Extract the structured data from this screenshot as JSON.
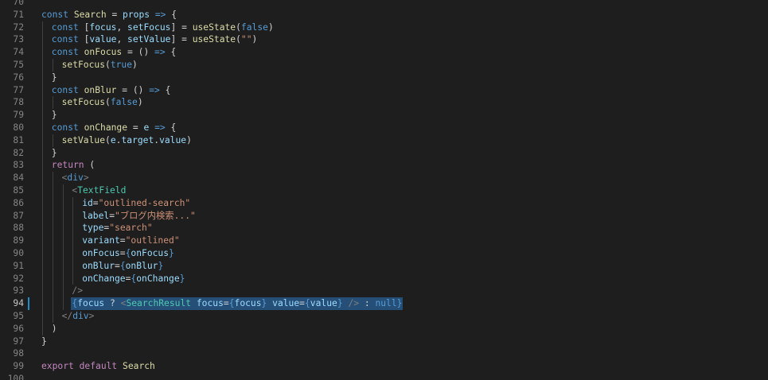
{
  "editor": {
    "language": "javascript-react",
    "active_line": 94,
    "colors": {
      "background": "#1e1e1e",
      "line_number": "#858585",
      "keyword": "#569cd6",
      "control": "#c586c0",
      "function": "#dcdcaa",
      "variable": "#9cdcfe",
      "string": "#ce9178",
      "jsx_tag": "#4ec9b0",
      "selection": "#264f78",
      "modified_gutter": "#1e8fc6"
    },
    "lines": [
      {
        "num": "70",
        "indent": 0,
        "tokens": []
      },
      {
        "num": "71",
        "indent": 0,
        "tokens": [
          [
            "kw",
            "const"
          ],
          [
            "txt",
            " "
          ],
          [
            "fn",
            "Search"
          ],
          [
            "txt",
            " = "
          ],
          [
            "var",
            "props"
          ],
          [
            "txt",
            " "
          ],
          [
            "kw",
            "=>"
          ],
          [
            "txt",
            " {"
          ]
        ]
      },
      {
        "num": "72",
        "indent": 1,
        "tokens": [
          [
            "kw",
            "const"
          ],
          [
            "txt",
            " ["
          ],
          [
            "var",
            "focus"
          ],
          [
            "txt",
            ", "
          ],
          [
            "var",
            "setFocus"
          ],
          [
            "txt",
            "] = "
          ],
          [
            "fn",
            "useState"
          ],
          [
            "txt",
            "("
          ],
          [
            "lit",
            "false"
          ],
          [
            "txt",
            ")"
          ]
        ]
      },
      {
        "num": "73",
        "indent": 1,
        "tokens": [
          [
            "kw",
            "const"
          ],
          [
            "txt",
            " ["
          ],
          [
            "var",
            "value"
          ],
          [
            "txt",
            ", "
          ],
          [
            "var",
            "setValue"
          ],
          [
            "txt",
            "] = "
          ],
          [
            "fn",
            "useState"
          ],
          [
            "txt",
            "("
          ],
          [
            "str",
            "\"\""
          ],
          [
            "txt",
            ")"
          ]
        ]
      },
      {
        "num": "74",
        "indent": 1,
        "tokens": [
          [
            "kw",
            "const"
          ],
          [
            "txt",
            " "
          ],
          [
            "fn",
            "onFocus"
          ],
          [
            "txt",
            " = () "
          ],
          [
            "kw",
            "=>"
          ],
          [
            "txt",
            " {"
          ]
        ]
      },
      {
        "num": "75",
        "indent": 2,
        "tokens": [
          [
            "fn",
            "setFocus"
          ],
          [
            "txt",
            "("
          ],
          [
            "lit",
            "true"
          ],
          [
            "txt",
            ")"
          ]
        ]
      },
      {
        "num": "76",
        "indent": 1,
        "tokens": [
          [
            "txt",
            "}"
          ]
        ]
      },
      {
        "num": "77",
        "indent": 1,
        "tokens": [
          [
            "kw",
            "const"
          ],
          [
            "txt",
            " "
          ],
          [
            "fn",
            "onBlur"
          ],
          [
            "txt",
            " = () "
          ],
          [
            "kw",
            "=>"
          ],
          [
            "txt",
            " {"
          ]
        ]
      },
      {
        "num": "78",
        "indent": 2,
        "tokens": [
          [
            "fn",
            "setFocus"
          ],
          [
            "txt",
            "("
          ],
          [
            "lit",
            "false"
          ],
          [
            "txt",
            ")"
          ]
        ]
      },
      {
        "num": "79",
        "indent": 1,
        "tokens": [
          [
            "txt",
            "}"
          ]
        ]
      },
      {
        "num": "80",
        "indent": 1,
        "tokens": [
          [
            "kw",
            "const"
          ],
          [
            "txt",
            " "
          ],
          [
            "fn",
            "onChange"
          ],
          [
            "txt",
            " = "
          ],
          [
            "var",
            "e"
          ],
          [
            "txt",
            " "
          ],
          [
            "kw",
            "=>"
          ],
          [
            "txt",
            " {"
          ]
        ]
      },
      {
        "num": "81",
        "indent": 2,
        "tokens": [
          [
            "fn",
            "setValue"
          ],
          [
            "txt",
            "("
          ],
          [
            "var",
            "e"
          ],
          [
            "txt",
            "."
          ],
          [
            "var",
            "target"
          ],
          [
            "txt",
            "."
          ],
          [
            "var",
            "value"
          ],
          [
            "txt",
            ")"
          ]
        ]
      },
      {
        "num": "82",
        "indent": 1,
        "tokens": [
          [
            "txt",
            "}"
          ]
        ]
      },
      {
        "num": "83",
        "indent": 1,
        "tokens": [
          [
            "ctl",
            "return"
          ],
          [
            "txt",
            " ("
          ]
        ]
      },
      {
        "num": "84",
        "indent": 2,
        "tokens": [
          [
            "tagp",
            "<"
          ],
          [
            "kw",
            "div"
          ],
          [
            "tagp",
            ">"
          ]
        ]
      },
      {
        "num": "85",
        "indent": 3,
        "tokens": [
          [
            "tagp",
            "<"
          ],
          [
            "tag",
            "TextField"
          ]
        ]
      },
      {
        "num": "86",
        "indent": 4,
        "tokens": [
          [
            "var",
            "id"
          ],
          [
            "txt",
            "="
          ],
          [
            "str",
            "\"outlined-search\""
          ]
        ]
      },
      {
        "num": "87",
        "indent": 4,
        "tokens": [
          [
            "var",
            "label"
          ],
          [
            "txt",
            "="
          ],
          [
            "str",
            "\"ブログ内検索...\""
          ]
        ]
      },
      {
        "num": "88",
        "indent": 4,
        "tokens": [
          [
            "var",
            "type"
          ],
          [
            "txt",
            "="
          ],
          [
            "str",
            "\"search\""
          ]
        ]
      },
      {
        "num": "89",
        "indent": 4,
        "tokens": [
          [
            "var",
            "variant"
          ],
          [
            "txt",
            "="
          ],
          [
            "str",
            "\"outlined\""
          ]
        ]
      },
      {
        "num": "90",
        "indent": 4,
        "tokens": [
          [
            "var",
            "onFocus"
          ],
          [
            "txt",
            "="
          ],
          [
            "kw",
            "{"
          ],
          [
            "var",
            "onFocus"
          ],
          [
            "kw",
            "}"
          ]
        ]
      },
      {
        "num": "91",
        "indent": 4,
        "tokens": [
          [
            "var",
            "onBlur"
          ],
          [
            "txt",
            "="
          ],
          [
            "kw",
            "{"
          ],
          [
            "var",
            "onBlur"
          ],
          [
            "kw",
            "}"
          ]
        ]
      },
      {
        "num": "92",
        "indent": 4,
        "tokens": [
          [
            "var",
            "onChange"
          ],
          [
            "txt",
            "="
          ],
          [
            "kw",
            "{"
          ],
          [
            "var",
            "onChange"
          ],
          [
            "kw",
            "}"
          ]
        ]
      },
      {
        "num": "93",
        "indent": 3,
        "tokens": [
          [
            "tagp",
            "/>"
          ]
        ]
      },
      {
        "num": "94",
        "indent": 3,
        "selected": true,
        "tokens": [
          [
            "kw",
            "{"
          ],
          [
            "var",
            "focus"
          ],
          [
            "txt",
            " ? "
          ],
          [
            "tagp",
            "<"
          ],
          [
            "tag",
            "SearchResult"
          ],
          [
            "txt",
            " "
          ],
          [
            "var",
            "focus"
          ],
          [
            "txt",
            "="
          ],
          [
            "kw",
            "{"
          ],
          [
            "var",
            "focus"
          ],
          [
            "kw",
            "}"
          ],
          [
            "txt",
            " "
          ],
          [
            "var",
            "value"
          ],
          [
            "txt",
            "="
          ],
          [
            "kw",
            "{"
          ],
          [
            "var",
            "value"
          ],
          [
            "kw",
            "}"
          ],
          [
            "txt",
            " "
          ],
          [
            "tagp",
            "/>"
          ],
          [
            "txt",
            " : "
          ],
          [
            "lit",
            "null"
          ],
          [
            "kw",
            "}"
          ]
        ]
      },
      {
        "num": "95",
        "indent": 2,
        "tokens": [
          [
            "tagp",
            "</"
          ],
          [
            "kw",
            "div"
          ],
          [
            "tagp",
            ">"
          ]
        ]
      },
      {
        "num": "96",
        "indent": 1,
        "tokens": [
          [
            "txt",
            ")"
          ]
        ]
      },
      {
        "num": "97",
        "indent": 0,
        "tokens": [
          [
            "txt",
            "}"
          ]
        ]
      },
      {
        "num": "98",
        "indent": 0,
        "tokens": []
      },
      {
        "num": "99",
        "indent": 0,
        "tokens": [
          [
            "ctl",
            "export"
          ],
          [
            "txt",
            " "
          ],
          [
            "ctl",
            "default"
          ],
          [
            "txt",
            " "
          ],
          [
            "fn",
            "Search"
          ]
        ]
      },
      {
        "num": "100",
        "indent": 0,
        "tokens": []
      }
    ]
  }
}
